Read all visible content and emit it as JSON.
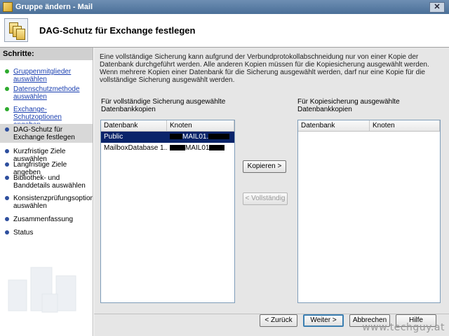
{
  "window": {
    "title": "Gruppe ändern - Mail",
    "close_glyph": "✕"
  },
  "header": {
    "title": "DAG-Schutz für Exchange festlegen",
    "icon": "copy-icon"
  },
  "sidebar": {
    "title": "Schritte:",
    "steps": [
      {
        "label": "Gruppenmitglieder auswählen",
        "state": "done"
      },
      {
        "label": "Datenschutzmethode auswählen",
        "state": "done"
      },
      {
        "label": "Exchange-Schutzoptionen angeben",
        "state": "done"
      },
      {
        "label": "DAG-Schutz für Exchange festlegen",
        "state": "current"
      },
      {
        "label": "Kurzfristige Ziele auswählen",
        "state": "pending"
      },
      {
        "label": "Langfristige Ziele angeben",
        "state": "pending"
      },
      {
        "label": "Bibliothek- und Banddetails auswählen",
        "state": "pending"
      },
      {
        "label": "Konsistenzprüfungsoptionen auswählen",
        "state": "pending"
      },
      {
        "label": "Zusammenfassung",
        "state": "pending"
      },
      {
        "label": "Status",
        "state": "pending"
      }
    ]
  },
  "main": {
    "description": "Eine vollständige Sicherung kann aufgrund der Verbundprotokollabschneidung nur von einer Kopie der Datenbank durchgeführt werden. Alle anderen Kopien müssen für die Kopiesicherung ausgewählt werden. Wenn mehrere Kopien einer Datenbank für die Sicherung ausgewählt werden, darf nur eine Kopie für die vollständige Sicherung ausgewählt werden.",
    "full_label": "Für vollständige Sicherung ausgewählte Datenbankkopien",
    "copy_label": "Für Kopiesicherung ausgewählte Datenbankkopien",
    "columns": {
      "database": "Datenbank",
      "node": "Knoten"
    },
    "full_rows": [
      {
        "database": "Public",
        "node": "MAIL01.",
        "selected": true
      },
      {
        "database": "MailboxDatabase 1...",
        "node": "MAIL01",
        "selected": false
      }
    ],
    "copy_button": "Kopieren >",
    "full_button": "< Vollständig"
  },
  "footer": {
    "back": "< Zurück",
    "next": "Weiter >",
    "cancel": "Abbrechen",
    "help": "Hilfe"
  },
  "watermark": "www.techguy.at"
}
